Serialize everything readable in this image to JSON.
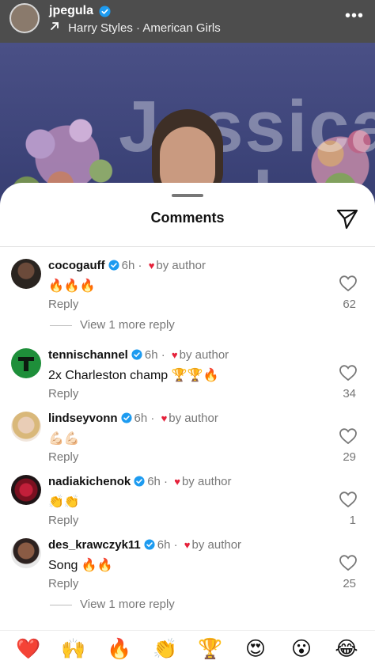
{
  "header": {
    "username": "jpegula",
    "song_artist": "Harry Styles",
    "separator": "·",
    "song_title": "American Girls"
  },
  "video_background": {
    "text_fragments": [
      "Jessica",
      "egula"
    ]
  },
  "sheet": {
    "title": "Comments"
  },
  "comments": [
    {
      "username": "cocogauff",
      "time": "6h",
      "liked_by": "by author",
      "text": "🔥🔥🔥",
      "reply_label": "Reply",
      "likes": "62",
      "view_more": "View 1 more reply"
    },
    {
      "username": "tennischannel",
      "time": "6h",
      "liked_by": "by author",
      "text": "2x Charleston champ 🏆🏆🔥",
      "reply_label": "Reply",
      "likes": "34"
    },
    {
      "username": "lindseyvonn",
      "time": "6h",
      "liked_by": "by author",
      "text": "💪🏻💪🏻",
      "reply_label": "Reply",
      "likes": "29"
    },
    {
      "username": "nadiakichenok",
      "time": "6h",
      "liked_by": "by author",
      "text": "👏👏",
      "reply_label": "Reply",
      "likes": "1"
    },
    {
      "username": "des_krawczyk11",
      "time": "6h",
      "liked_by": "by author",
      "text": "Song 🔥🔥",
      "reply_label": "Reply",
      "likes": "25",
      "view_more": "View 1 more reply"
    }
  ],
  "emoji_bar": [
    "❤️",
    "🙌",
    "🔥",
    "👏",
    "🏆",
    "😍",
    "😮",
    "😂"
  ],
  "colors": {
    "verified": "#1d9bf0",
    "heart": "#e5213a",
    "meta_gray": "#777777"
  },
  "icons": {
    "share": "paper-plane-icon",
    "like": "heart-outline-icon",
    "more": "more-horizontal-icon",
    "verified": "verified-badge-icon"
  }
}
